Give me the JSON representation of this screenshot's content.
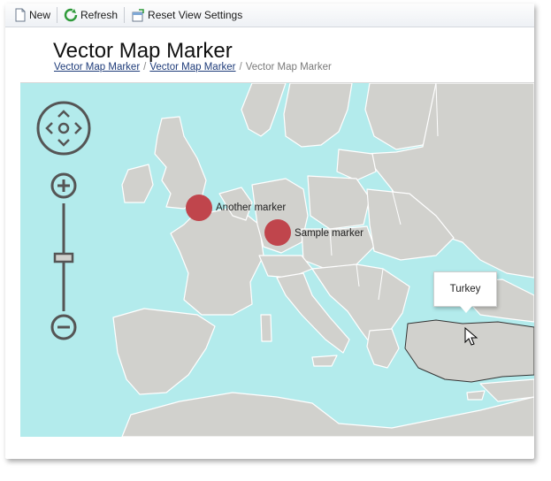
{
  "toolbar": {
    "new_label": "New",
    "refresh_label": "Refresh",
    "reset_label": "Reset View Settings"
  },
  "page": {
    "title": "Vector Map Marker",
    "breadcrumb": [
      "Vector Map Marker",
      "Vector Map Marker",
      "Vector Map Marker"
    ]
  },
  "map": {
    "water_color": "#b3ebec",
    "land_color": "#d1d1cd",
    "highlight_color": "#cfcfcb",
    "marker_color": "#c0454c",
    "markers": [
      {
        "label": "Another marker"
      },
      {
        "label": "Sample marker"
      }
    ],
    "tooltip": "Turkey",
    "zoom_level": 0.5
  },
  "icons": {
    "pan": "pan-control-icon",
    "zoom_in": "zoom-in-icon",
    "zoom_out": "zoom-out-icon",
    "cursor": "mouse-pointer-icon"
  }
}
